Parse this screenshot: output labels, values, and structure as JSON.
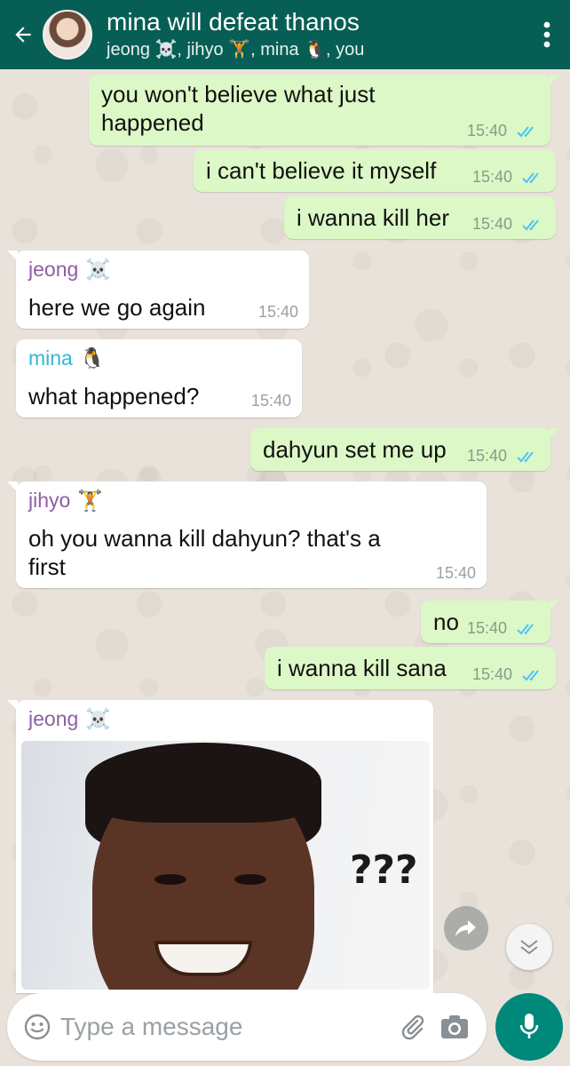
{
  "header": {
    "title": "mina will defeat thanos",
    "subtitle": "jeong ☠️, jihyo 🏋️, mina 🐧, you"
  },
  "messages": [
    {
      "dir": "out",
      "text_line1": "you won't believe what just",
      "text_line2": "happened",
      "time": "15:40"
    },
    {
      "dir": "out",
      "text": "i can't believe it myself",
      "time": "15:40"
    },
    {
      "dir": "out",
      "text": "i wanna kill her",
      "time": "15:40"
    },
    {
      "dir": "in",
      "sender": "jeong",
      "sender_emoji": "☠️",
      "sender_color": "#8e5ea2",
      "text": "here we go again",
      "time": "15:40"
    },
    {
      "dir": "in",
      "sender": "mina",
      "sender_emoji": "🐧",
      "sender_color": "#35b6d4",
      "text": "what happened?",
      "time": "15:40"
    },
    {
      "dir": "out",
      "text": "dahyun set me up",
      "time": "15:40"
    },
    {
      "dir": "in",
      "sender": "jihyo",
      "sender_emoji": "🏋️",
      "sender_color": "#8e5ea2",
      "text_line1": "oh you wanna kill dahyun? that's a",
      "text_line2": "first",
      "time": "15:40"
    },
    {
      "dir": "out",
      "text": "no",
      "time": "15:40"
    },
    {
      "dir": "out",
      "text": "i wanna kill sana",
      "time": "15:40"
    },
    {
      "dir": "in",
      "sender": "jeong",
      "sender_emoji": "☠️",
      "sender_color": "#8e5ea2",
      "image_text": "???"
    }
  ],
  "input": {
    "placeholder": "Type a message"
  },
  "colors": {
    "header_bg": "#075e54",
    "outgoing_bubble": "#dcf8c6",
    "incoming_bubble": "#ffffff",
    "read_tick": "#4fc3f7",
    "mic_button": "#00897b"
  },
  "icons": [
    "back-arrow-icon",
    "more-vert-icon",
    "double-check-icon",
    "forward-icon",
    "scroll-down-icon",
    "emoji-icon",
    "attach-icon",
    "camera-icon",
    "mic-icon"
  ]
}
